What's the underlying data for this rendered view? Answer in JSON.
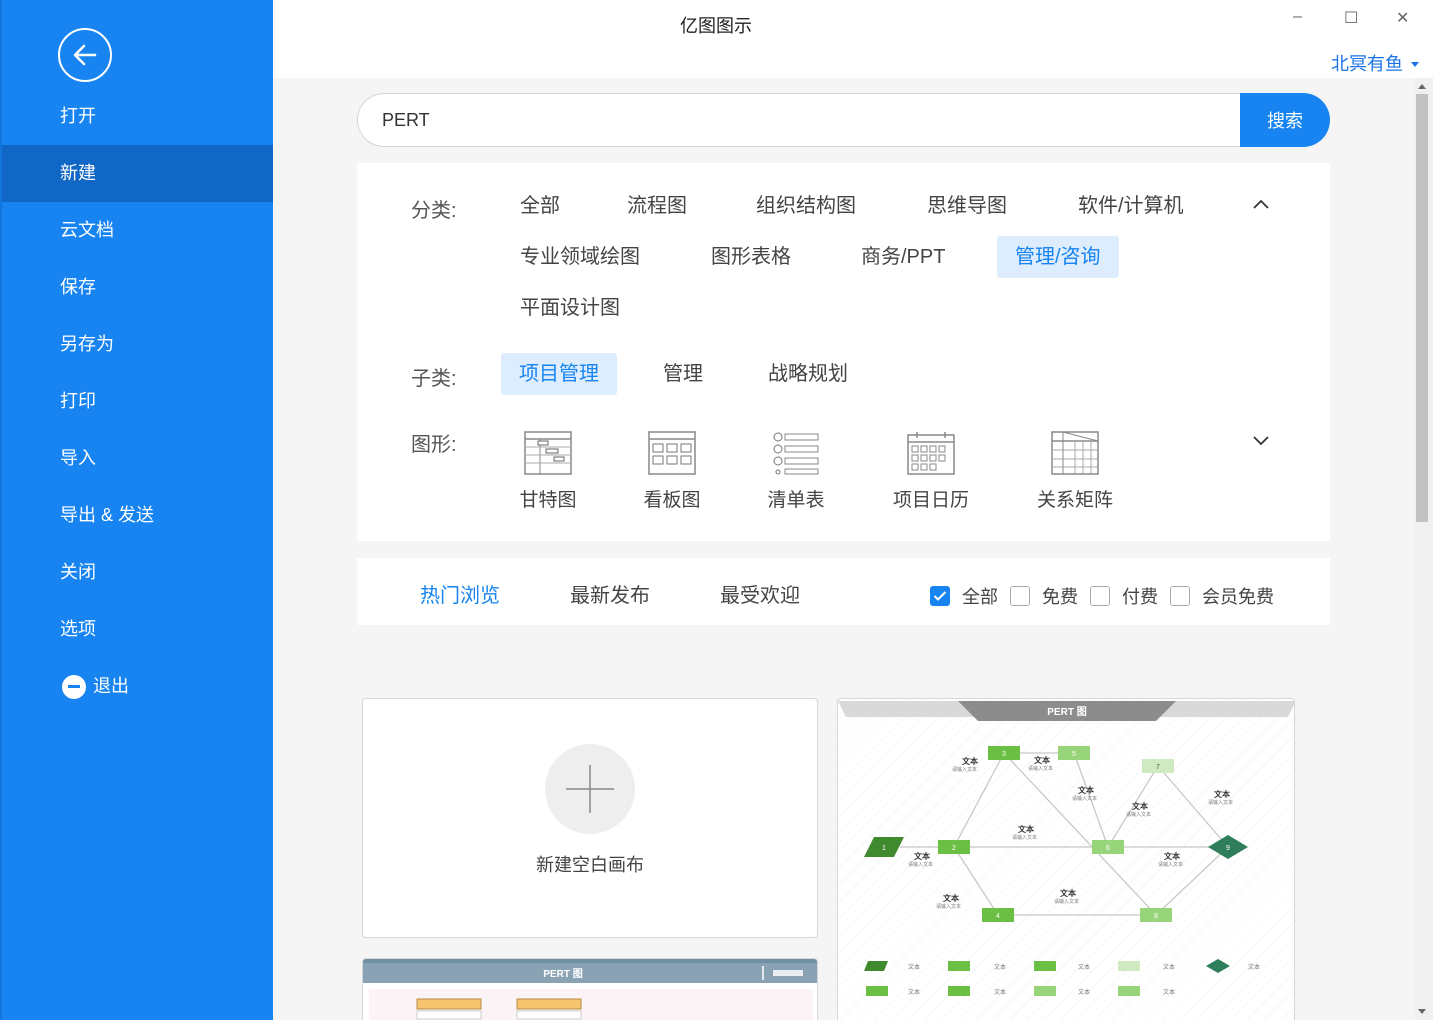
{
  "app": {
    "title": "亿图图示",
    "user": "北冥有鱼"
  },
  "window": {
    "minimize": "–",
    "maximize": "☐",
    "close": "✕"
  },
  "sidebar": {
    "items": [
      {
        "label": "打开"
      },
      {
        "label": "新建",
        "active": true
      },
      {
        "label": "云文档"
      },
      {
        "label": "保存"
      },
      {
        "label": "另存为"
      },
      {
        "label": "打印"
      },
      {
        "label": "导入"
      },
      {
        "label": "导出 & 发送"
      },
      {
        "label": "关闭"
      },
      {
        "label": "选项"
      },
      {
        "label": "退出"
      }
    ]
  },
  "search": {
    "value": "PERT",
    "button": "搜索"
  },
  "filters": {
    "category_label": "分类:",
    "categories": [
      "全部",
      "流程图",
      "组织结构图",
      "思维导图",
      "软件/计算机",
      "专业领域绘图",
      "图形表格",
      "商务/PPT",
      "管理/咨询",
      "平面设计图"
    ],
    "selected_category": "管理/咨询",
    "subcategory_label": "子类:",
    "subcategories": [
      "项目管理",
      "管理",
      "战略规划"
    ],
    "selected_subcategory": "项目管理",
    "shape_label": "图形:",
    "shapes": [
      {
        "label": "甘特图",
        "icon": "gantt-icon"
      },
      {
        "label": "看板图",
        "icon": "kanban-icon"
      },
      {
        "label": "清单表",
        "icon": "checklist-icon"
      },
      {
        "label": "项目日历",
        "icon": "calendar-icon"
      },
      {
        "label": "关系矩阵",
        "icon": "matrix-icon"
      }
    ]
  },
  "sort": {
    "tabs": [
      "热门浏览",
      "最新发布",
      "最受欢迎"
    ],
    "active_tab": "热门浏览",
    "checkboxes": [
      {
        "label": "全部",
        "checked": true
      },
      {
        "label": "免费",
        "checked": false
      },
      {
        "label": "付费",
        "checked": false
      },
      {
        "label": "会员免费",
        "checked": false
      }
    ]
  },
  "templates": {
    "new_blank": "新建空白画布",
    "pert_title": "PERT 图",
    "pert_node_text": "文本",
    "pert_node_sub": "请输入文本",
    "pert_nodes": [
      "1",
      "2",
      "3",
      "4",
      "5",
      "6",
      "7",
      "8",
      "9"
    ]
  },
  "colors": {
    "accent": "#1784f1",
    "sidebar": "#1784f1",
    "sidebar_active": "#1167c6",
    "pert_green": "#6bbf45",
    "pert_dark": "#3f8a2f"
  }
}
